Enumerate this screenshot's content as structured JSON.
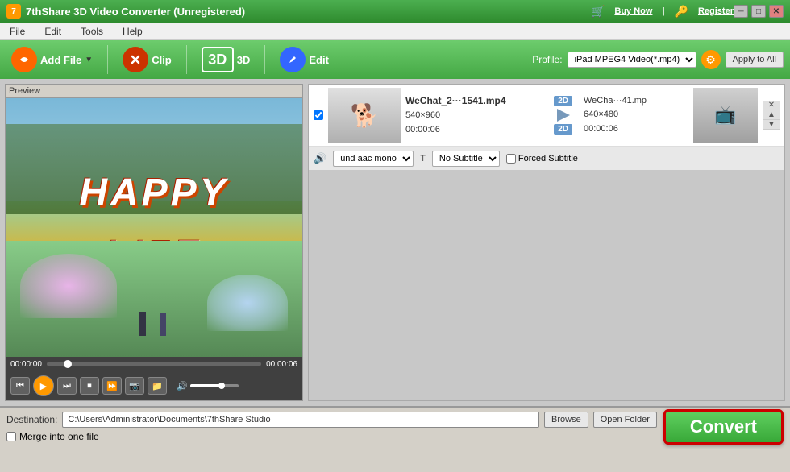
{
  "titleBar": {
    "title": "7thShare 3D Video Converter (Unregistered)",
    "controls": {
      "minimize": "─",
      "maximize": "□",
      "close": "✕"
    },
    "buyNow": "Buy Now",
    "register": "Register"
  },
  "menuBar": {
    "items": [
      "File",
      "Edit",
      "Tools",
      "Help"
    ]
  },
  "toolbar": {
    "addFile": "Add File",
    "clip": "Clip",
    "3d": "3D",
    "edit": "Edit",
    "profileLabel": "Profile:",
    "profileValue": "iPad MPEG4 Video(*.mp4)",
    "applyToAll": "Apply to All"
  },
  "preview": {
    "label": "Preview",
    "happyText": "HAPPY",
    "lifeText": "LIFE",
    "timeStart": "00:00:00",
    "timeEnd": "00:00:06"
  },
  "fileList": {
    "items": [
      {
        "id": 1,
        "filename": "WeChat_2···1541.mp4",
        "resolution": "540×960",
        "duration": "00:00:06",
        "badge": "2D",
        "outputFilename": "WeCha···41.mp",
        "outputResolution": "640×480",
        "outputDuration": "00:00:06",
        "outputBadge": "2D"
      }
    ],
    "audio": {
      "icon": "🔊",
      "value": "und aac mono"
    },
    "subtitle": {
      "icon": "T",
      "value": "No Subtitle",
      "label": "Subtitle"
    },
    "forcedSubtitle": {
      "label": "Forced Subtitle"
    }
  },
  "destination": {
    "label": "Destination:",
    "path": "C:\\Users\\Administrator\\Documents\\7thShare Studio",
    "browseLabel": "Browse",
    "openFolderLabel": "Open Folder"
  },
  "convertBtn": {
    "label": "Convert"
  },
  "mergeCheckbox": {
    "label": "Merge into one file"
  }
}
